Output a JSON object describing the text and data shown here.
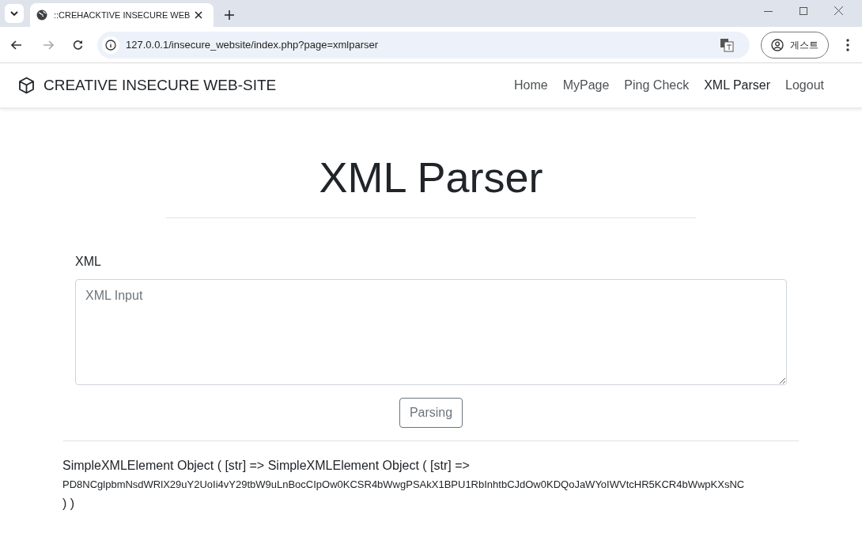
{
  "browser": {
    "tab_title": "::CREHACKTIVE INSECURE WEB",
    "url": "127.0.0.1/insecure_website/index.php?page=xmlparser",
    "profile": "게스트"
  },
  "navbar": {
    "brand": "CREATIVE INSECURE WEB-SITE",
    "links": [
      {
        "label": "Home",
        "selected": false
      },
      {
        "label": "MyPage",
        "selected": false
      },
      {
        "label": "Ping Check",
        "selected": false
      },
      {
        "label": "XML Parser",
        "selected": true
      },
      {
        "label": "Logout",
        "selected": false
      }
    ]
  },
  "heading": "XML Parser",
  "form": {
    "label": "XML",
    "placeholder": "XML Input",
    "button": "Parsing"
  },
  "result": [
    "SimpleXMLElement Object ( [str] => SimpleXMLElement Object ( [str] =>",
    "PD8NCglpbmNsdWRlX29uY2UoIi4vY29tbW9uLnBocCIpOw0KCSR4bWwgPSAkX1BPU1RbInhtbCJdOw0KDQoJaWYoIWVtcHR5KCR4bWwpKXsNC",
    ") )"
  ]
}
